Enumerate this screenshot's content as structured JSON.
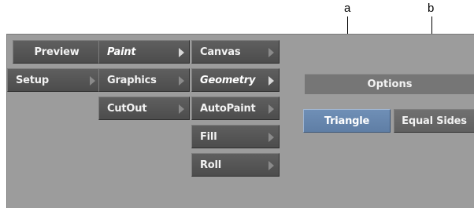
{
  "callouts": {
    "a": "a",
    "b": "b"
  },
  "menu": {
    "col1": [
      {
        "label": "Preview",
        "arrow": false,
        "active": false
      },
      {
        "label": "Setup",
        "arrow": true,
        "active": false
      }
    ],
    "col2": [
      {
        "label": "Paint",
        "arrow": true,
        "active": true
      },
      {
        "label": "Graphics",
        "arrow": true,
        "active": false
      },
      {
        "label": "CutOut",
        "arrow": true,
        "active": false
      }
    ],
    "col3": [
      {
        "label": "Canvas",
        "arrow": true,
        "active": false
      },
      {
        "label": "Geometry",
        "arrow": true,
        "active": true
      },
      {
        "label": "AutoPaint",
        "arrow": true,
        "active": false
      },
      {
        "label": "Fill",
        "arrow": true,
        "active": false
      },
      {
        "label": "Roll",
        "arrow": true,
        "active": false
      }
    ]
  },
  "options": {
    "header": "Options",
    "shape_button": "Triangle",
    "equal_sides_button": "Equal Sides"
  },
  "colors": {
    "background": "#9c9c9c",
    "button": "#555555",
    "selected_button": "#6585ad"
  },
  "icons": {
    "submenu_arrow": "arrow-right-icon"
  }
}
